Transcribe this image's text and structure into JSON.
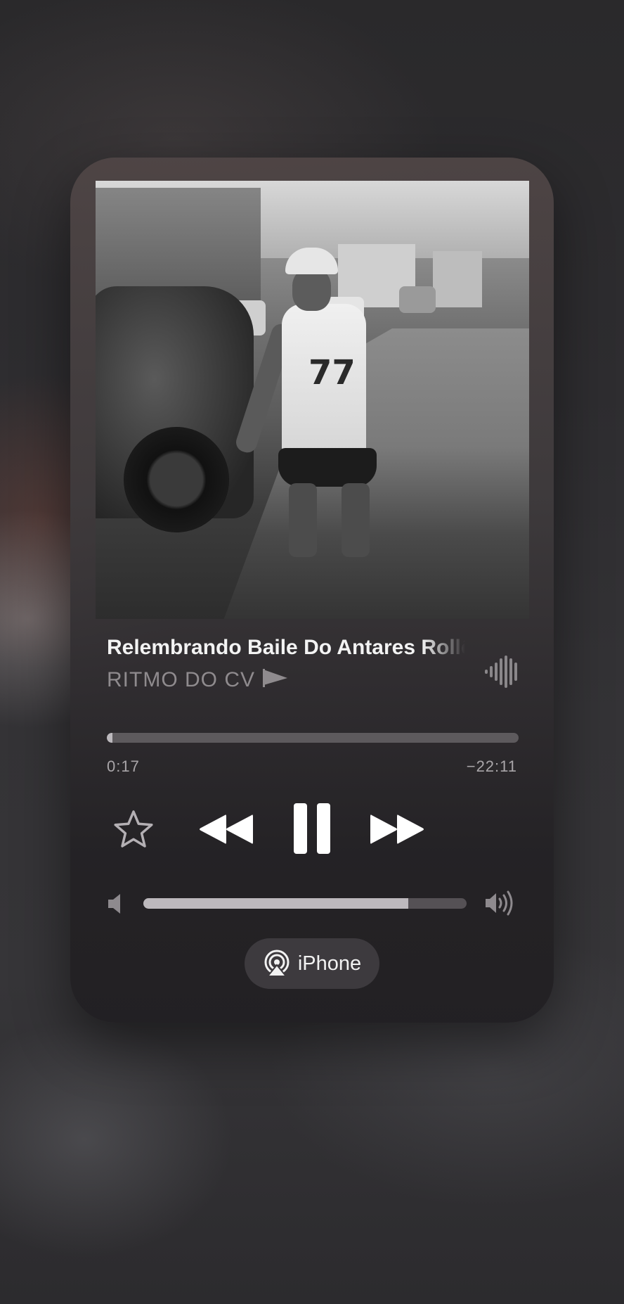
{
  "now_playing": {
    "title": "Relembrando Baile Do Antares Rollê",
    "artist": "RITMO DO CV",
    "artwork_icon": "album-artwork",
    "artwork_number": "77"
  },
  "progress": {
    "elapsed": "0:17",
    "remaining": "−22:11",
    "fraction": 0.013
  },
  "controls": {
    "favorite_icon": "star-icon",
    "rewind_icon": "rewind-icon",
    "pause_icon": "pause-icon",
    "forward_icon": "fast-forward-icon"
  },
  "volume": {
    "level": 0.82,
    "low_icon": "speaker-low-icon",
    "high_icon": "speaker-high-icon"
  },
  "route": {
    "label": "iPhone",
    "icon": "airplay-icon"
  },
  "colors": {
    "title": "#f3f3f3",
    "subtitle": "#8f8b8e",
    "track": "#5d5a5d",
    "fill": "#bcb9bd"
  }
}
